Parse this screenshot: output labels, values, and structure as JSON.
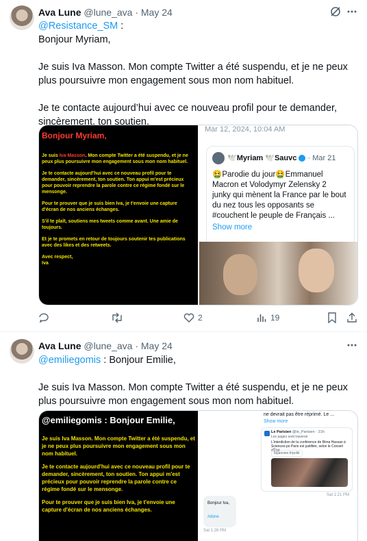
{
  "tweets": [
    {
      "author": "Ava Lune",
      "handle": "@lune_ava",
      "separator": "·",
      "date": "May 24",
      "mention": "@Resistance_SM",
      "after_mention": " :",
      "paragraphs": [
        "Bonjour Myriam,",
        "Je suis Iva Masson. Mon compte Twitter a été suspendu, et je ne peux plus poursuivre mon engagement sous mon nom habituel.",
        "Je te contacte aujourd’hui avec ce nouveau profil pour te demander, sincèrement, ton soutien."
      ],
      "media": {
        "left_image": {
          "heading": "Bonjour Myriam,",
          "line1_prefix": "Je suis ",
          "line1_name": "Iva Masson",
          "line1_rest": ". Mon compte Twitter a été suspendu, et je ne peux plus poursuivre mon engagement sous mon nom habituel.",
          "p2": "Je te contacte aujourd'hui avec ce nouveau profil pour te demander, sincèrement, ton soutien. Ton appui m'est précieux pour pouvoir reprendre la parole contre ce régime fondé sur le mensonge.",
          "p3": "Pour te prouver que je suis bien Iva, je t'envoie une capture d'écran de nos anciens échanges.",
          "p4": "S'il te plaît, soutiens mes tweets comme avant. Une amie de toujours.",
          "p5": "Et je te promets en retour de toujours soutenir tes publications avec des likes et des retweets.",
          "p6": "Avec respect,",
          "p7": "Iva"
        },
        "right_image": {
          "timestamp": "Mar 12, 2024, 10:04 AM",
          "card_author": "🕊️Myriam 🕊️Sauvc",
          "card_date": "· Mar 21",
          "card_text": "🤮Parodie du jour🤮Emmanuel Macron et Volodymyr Zelensky 2 junky qui mènent la France par le bout du nez tous les opposants se #couchent le peuple de Français ...",
          "show_more": "Show more"
        }
      },
      "actions": {
        "replies": "",
        "reposts": "",
        "likes": "2",
        "views": "19"
      }
    },
    {
      "author": "Ava Lune",
      "handle": "@lune_ava",
      "separator": "·",
      "date": "May 24",
      "mention": "@emiliegomis",
      "after_mention": " : Bonjour Emilie,",
      "paragraphs": [
        "Je suis Iva Masson. Mon compte Twitter a été suspendu, et je ne peux plus poursuivre mon engagement sous mon nom habituel."
      ],
      "media": {
        "left_image": {
          "heading": "@emiliegomis : Bonjour Emilie,",
          "p1": "Je suis Iva Masson. Mon compte Twitter a été suspendu, et je ne peux plus poursuivre mon engagement sous mon nom habituel.",
          "p2": "Je te contacte aujourd'hui avec ce nouveau profil pour te demander, sincèrement, ton soutien. Ton appui m'est précieux pour pouvoir reprendre la parole contre ce régime fondé sur le mensonge.",
          "p3": "Pour te prouver que je suis bien Iva, je t'envoie une capture d'écran de nos anciens échanges."
        },
        "right_image": {
          "top_text": "ne devrait pas être réprimé. Le ...",
          "show_more": "Show more",
          "source_name": "Le Parisien",
          "source_handle": "@le_Parisien · 21h",
          "source_sub": "Les pages sont traversé",
          "source_body": "L'interdiction de la conférence de Rima Hassan à Sciences-po Paris est justifiée, selon le Conseil d'État",
          "source_link": "leparisien.fr/politi",
          "time1": "Sat 1:21 PM",
          "bubble_text": "Bonjour Iva,",
          "bubble_tag": "#done",
          "time2": "Sat 1:28 PM"
        }
      }
    }
  ],
  "icons": {
    "grok": "grok-icon",
    "more": "more-icon",
    "reply": "reply-icon",
    "repost": "repost-icon",
    "like": "like-icon",
    "views": "views-icon",
    "bookmark": "bookmark-icon",
    "share": "share-icon"
  },
  "colors": {
    "link": "#1d9bf0",
    "secondary": "#536471",
    "yellow": "#f5e400",
    "red": "#ff3b2f"
  }
}
